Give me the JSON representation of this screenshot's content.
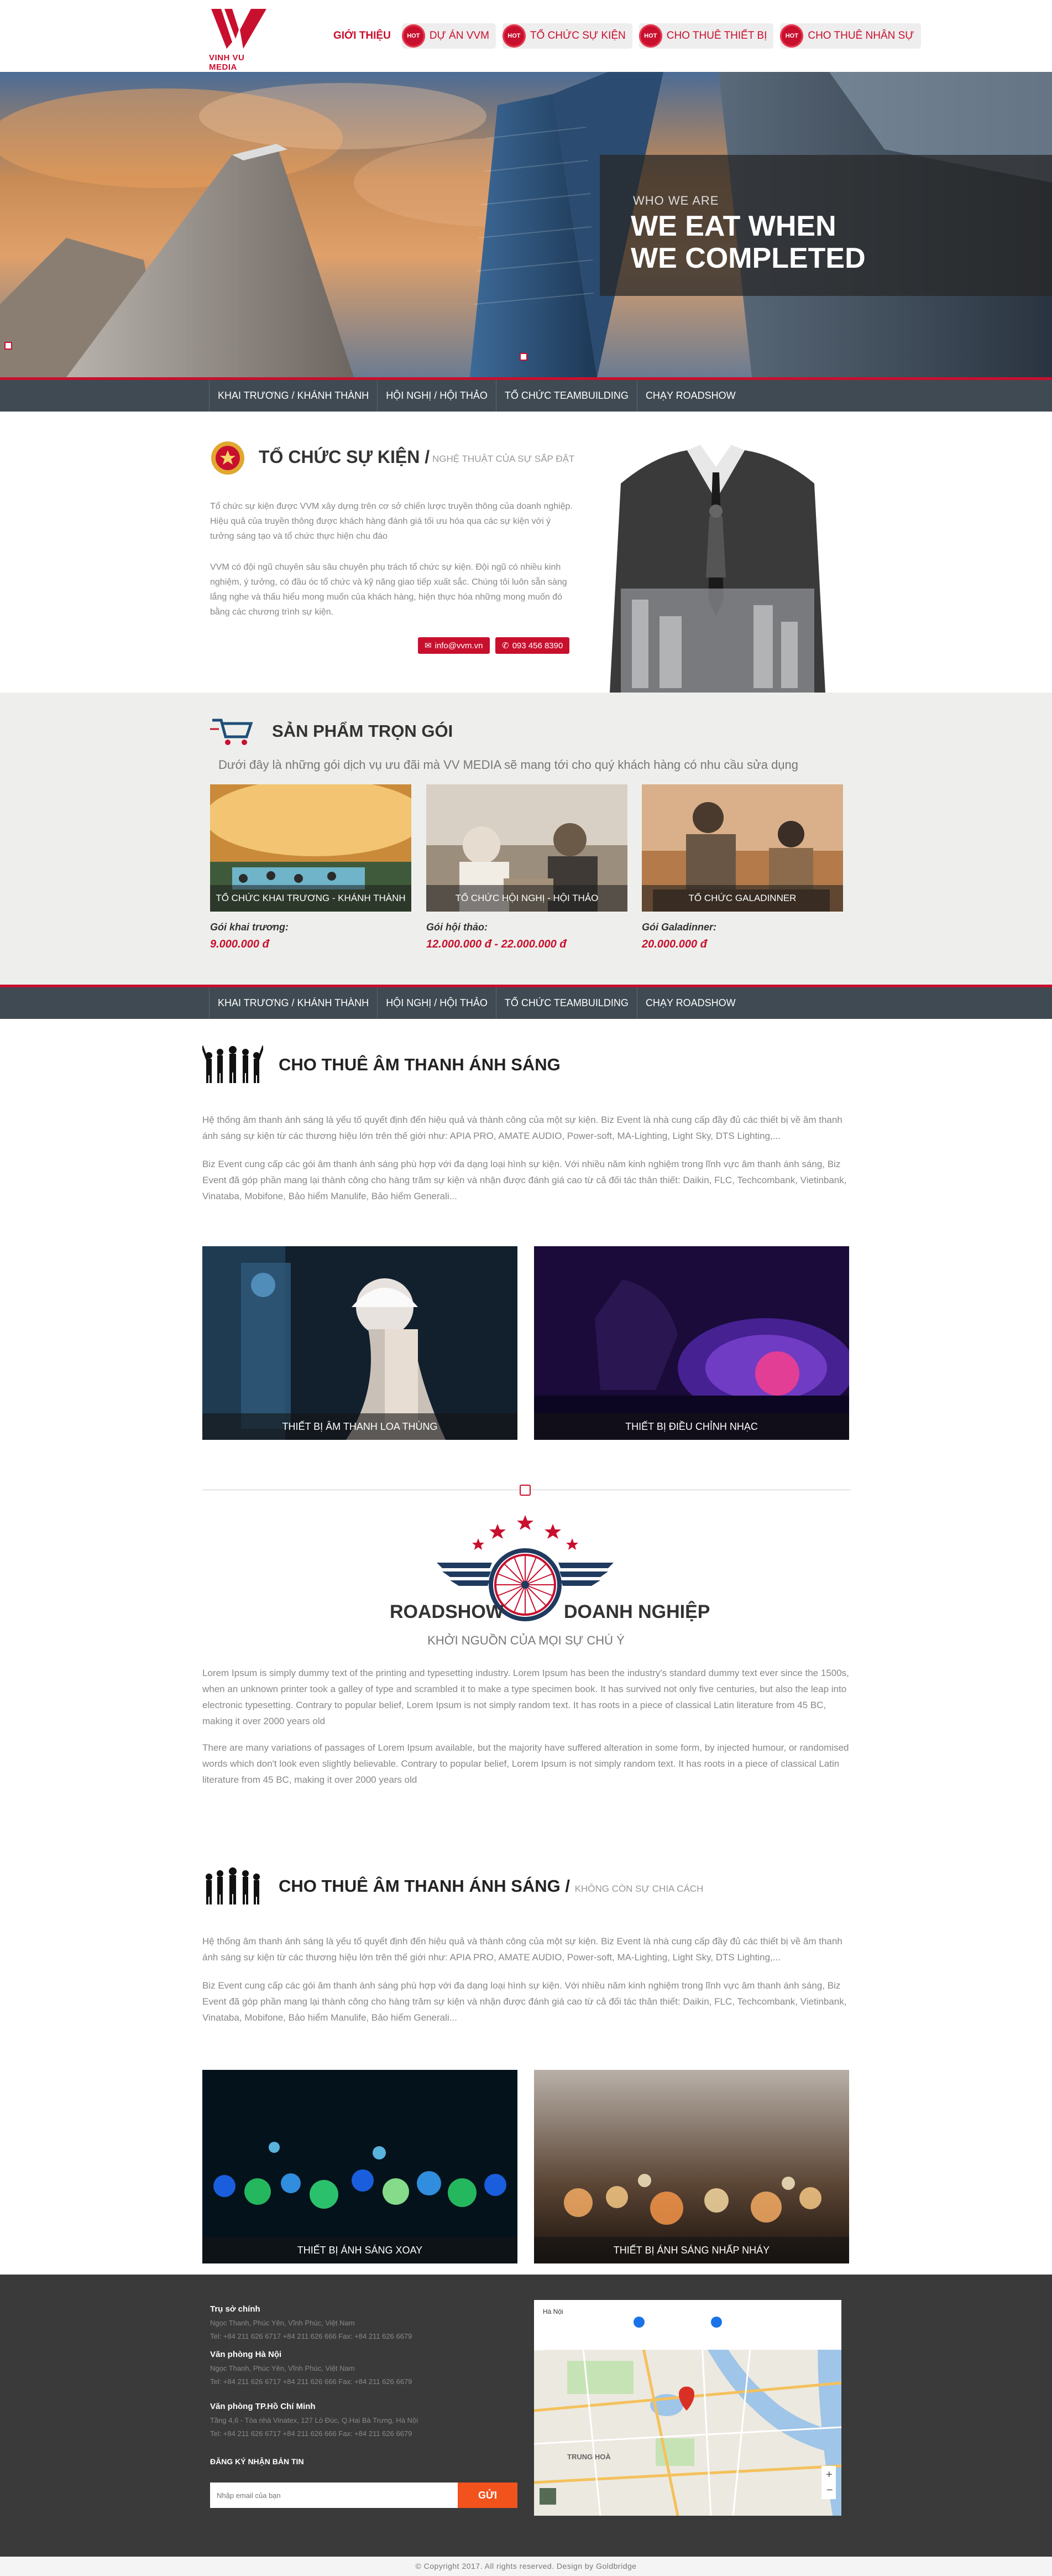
{
  "header": {
    "logo_text": "VINH VU MEDIA",
    "nav": [
      {
        "label": "GIỚI THIỆU",
        "hot": false
      },
      {
        "label": "DỰ ÁN VVM",
        "hot": true
      },
      {
        "label": "TỔ CHỨC SỰ KIỆN",
        "hot": true
      },
      {
        "label": "CHO THUÊ THIẾT BỊ",
        "hot": true
      },
      {
        "label": "CHO THUÊ NHÂN SỰ",
        "hot": true
      }
    ],
    "hot_badge": "HOT"
  },
  "hero": {
    "small": "WHO WE ARE",
    "title_line1": "WE EAT WHEN",
    "title_line2": "WE COMPLETED"
  },
  "subnav": {
    "items": [
      "KHAI TRƯƠNG / KHÁNH THÀNH",
      "HỘI NGHỊ / HỘI THẢO",
      "TỔ CHỨC TEAMBUILDING",
      "CHẠY ROADSHOW"
    ]
  },
  "about": {
    "title": "TỔ CHỨC SỰ KIỆN /",
    "subtitle": "NGHỆ THUẬT CỦA SỰ SẮP ĐẶT",
    "p1": "Tổ chức sự kiện được VVM xây dựng trên cơ sở chiến lược truyền thông của doanh nghiệp. Hiệu quả của truyền thông được khách hàng đánh giá tối ưu hóa qua các sự kiện với ý tưởng sáng tạo và tổ chức thực hiện chu đáo",
    "p2": "VVM có đội ngũ chuyên sâu sâu chuyên phụ trách tổ chức sự kiện. Đội ngũ có nhiều kinh nghiệm, ý tưởng, có đầu óc tổ chức và kỹ năng giao tiếp xuất sắc. Chúng tôi luôn sẵn sàng lắng nghe và thấu hiểu mong muốn của khách hàng, hiện thực hóa những mong muốn đó bằng các chương trình sự kiện.",
    "email": "info@vvm.vn",
    "phone": "093 456 8390"
  },
  "packages": {
    "title": "SẢN PHẨM TRỌN GÓI",
    "desc": "Dưới đây là những gói dịch vụ ưu đãi mà VV MEDIA sẽ mang tới cho quý khách hàng có nhu cầu sửa dụng",
    "items": [
      {
        "caption": "TỔ CHỨC KHAI TRƯƠNG - KHÁNH THÀNH",
        "label": "Gói khai trương:",
        "price": "9.000.000 đ"
      },
      {
        "caption": "TỔ CHỨC HỘI NGHỊ - HỘI THẢO",
        "label": "Gói hội thảo:",
        "price": "12.000.000 đ - 22.000.000 đ"
      },
      {
        "caption": "TỔ CHỨC GALADINNER",
        "label": "Gói Galadinner:",
        "price": "20.000.000 đ"
      }
    ]
  },
  "sound": {
    "title": "CHO THUÊ ÂM THANH ÁNH SÁNG",
    "p1": "Hệ thống âm thanh ánh sáng là yếu tố quyết định đến hiệu quả và thành công của một sự kiện. Biz Event là nhà cung cấp đầy đủ các thiết bị về âm thanh ánh sáng sự kiện từ các thương hiệu lớn trên thế giới như: APIA PRO, AMATE AUDIO, Power-soft, MA-Lighting, Light Sky, DTS Lighting,...",
    "p2": "Biz Event cung cấp các gói âm thanh ánh sáng phù hợp với đa dạng loại hình sự kiện. Với nhiều năm kinh nghiệm trong lĩnh vực âm thanh ánh sáng, Biz Event đã góp phần mang lại thành công cho hàng trăm sự kiện và nhận được đánh giá cao từ cả đối tác thân thiết: Daikin, FLC, Techcombank, Vietinbank, Vinataba, Mobifone, Bảo hiểm Manulife, Bảo hiểm Generali...",
    "photo1": "THIẾT BỊ ÂM THANH LOA THÙNG",
    "photo2": "THIẾT BỊ ĐIỀU CHỈNH NHẠC"
  },
  "roadshow": {
    "left": "ROADSHOW",
    "right": "DOANH NGHIỆP",
    "sub": "KHỞI NGUỒN CỦA MỌI SỰ CHÚ Ý",
    "p1": "Lorem Ipsum is simply dummy text of the printing and typesetting industry. Lorem Ipsum has been the industry's standard dummy text ever since the 1500s, when an unknown printer took a galley of type and scrambled it to make a type specimen book. It has survived not only five centuries, but also the leap into electronic typesetting. Contrary to popular belief, Lorem Ipsum is not simply random text. It has roots in a piece of classical Latin literature from 45 BC, making it over 2000 years old",
    "p2": "There are many variations of passages of Lorem Ipsum available, but the majority have suffered alteration in some form, by injected humour, or randomised words which don't look even slightly believable. Contrary to popular belief, Lorem Ipsum is not simply random text. It has roots in a piece of classical Latin literature from 45 BC, making it over 2000 years old"
  },
  "lighting": {
    "title": "CHO THUÊ ÂM THANH ÁNH SÁNG /",
    "subtitle": "KHÔNG CÒN SỰ CHIA CÁCH",
    "p1": "Hệ thống âm thanh ánh sáng là yếu tố quyết định đến hiệu quả và thành công của một sự kiện. Biz Event là nhà cung cấp đầy đủ các thiết bị về âm thanh ánh sáng sự kiện từ các thương hiệu lớn trên thế giới như: APIA PRO, AMATE AUDIO, Power-soft, MA-Lighting, Light Sky, DTS Lighting,...",
    "p2": "Biz Event cung cấp các gói âm thanh ánh sáng phù hợp với đa dạng loại hình sự kiện. Với nhiều năm kinh nghiệm trong lĩnh vực âm thanh ánh sáng, Biz Event đã góp phần mang lại thành công cho hàng trăm sự kiện và nhận được đánh giá cao từ cả đối tác thân thiết: Daikin, FLC, Techcombank, Vietinbank, Vinataba, Mobifone, Bảo hiểm Manulife, Bảo hiểm Generali...",
    "photo1": "THIẾT BỊ ÁNH SÁNG XOAY",
    "photo2": "THIẾT BỊ ÁNH SÁNG NHẤP NHÁY"
  },
  "footer": {
    "h1": "Trụ sở chính",
    "l1a": "Ngọc Thanh, Phúc Yên, Vĩnh Phúc, Việt Nam",
    "l1b": "Tel: +84 211 626 6717 +84 211 626 666  Fax: +84 211 626 6679",
    "h2": "Văn phòng Hà Nội",
    "l2a": "Ngọc Thanh, Phúc Yên, Vĩnh Phúc, Việt Nam",
    "l2b": "Tel: +84 211 626 6717 +84 211 626 666  Fax: +84 211 626 6679",
    "h3": "Văn phòng TP.Hồ Chí Minh",
    "l3a": "Tầng 4,6 - Tòa nhà Vinatex, 127 Lò Đúc, Q.Hai Bà Trưng, Hà Nội",
    "l3b": "Tel: +84 211 626 6717 +84 211 626 666  Fax: +84 211 626 6679",
    "newsletter": "ĐĂNG KÝ NHẬN BẢN TIN",
    "input_placeholder": "Nhập email của bạn",
    "button": "GỬI",
    "map_city": "Hà Nội",
    "map_area": "TRUNG HOÀ"
  },
  "copyright": "© Copyright 2017. All rights reserved. Design by Goldbridge"
}
